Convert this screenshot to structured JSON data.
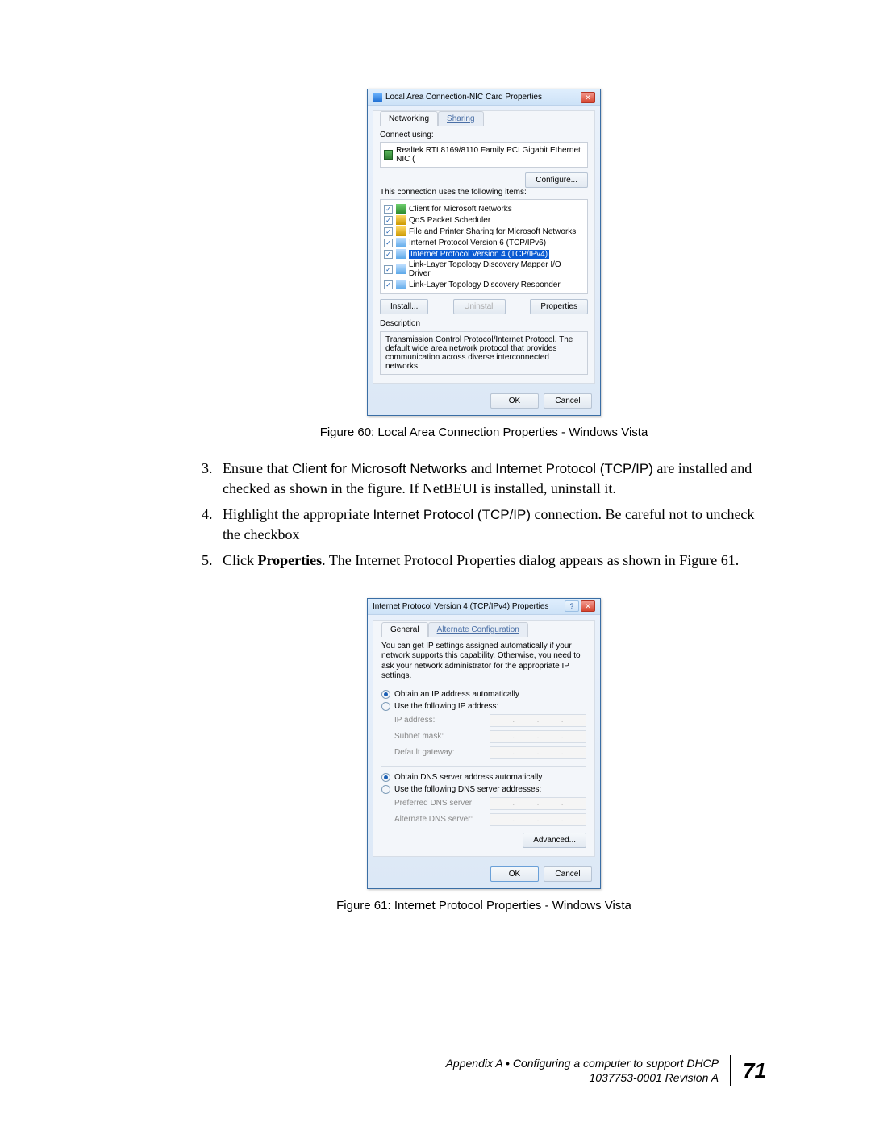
{
  "dialog1": {
    "title": "Local Area Connection-NIC Card Properties",
    "tabs": [
      "Networking",
      "Sharing"
    ],
    "connect_label": "Connect using:",
    "adapter": "Realtek RTL8169/8110 Family PCI Gigabit Ethernet NIC (",
    "configure_btn": "Configure...",
    "uses_label": "This connection uses the following items:",
    "items": [
      "Client for Microsoft Networks",
      "QoS Packet Scheduler",
      "File and Printer Sharing for Microsoft Networks",
      "Internet Protocol Version 6 (TCP/IPv6)",
      "Internet Protocol Version 4 (TCP/IPv4)",
      "Link-Layer Topology Discovery Mapper I/O Driver",
      "Link-Layer Topology Discovery Responder"
    ],
    "install_btn": "Install...",
    "uninstall_btn": "Uninstall",
    "properties_btn": "Properties",
    "desc_label": "Description",
    "desc_text": "Transmission Control Protocol/Internet Protocol. The default wide area network protocol that provides communication across diverse interconnected networks.",
    "ok": "OK",
    "cancel": "Cancel"
  },
  "caption1": "Figure 60: Local Area Connection Properties - Windows Vista",
  "steps": {
    "s3a": "Ensure that ",
    "s3b": "Client for Microsoft Networks",
    "s3c": " and ",
    "s3d": "Internet Protocol (TCP/IP)",
    "s3e": " are installed and checked as shown in the figure. If NetBEUI is installed, uninstall it.",
    "s4a": "Highlight the appropriate ",
    "s4b": "Internet Protocol (TCP/IP)",
    "s4c": " connection. Be careful not to uncheck the checkbox",
    "s5a": "Click ",
    "s5b": "Properties",
    "s5c": ". The Internet Protocol Properties dialog appears as shown in Figure 61."
  },
  "dialog2": {
    "title": "Internet Protocol Version 4 (TCP/IPv4) Properties",
    "tabs": [
      "General",
      "Alternate Configuration"
    ],
    "note": "You can get IP settings assigned automatically if your network supports this capability. Otherwise, you need to ask your network administrator for the appropriate IP settings.",
    "r1": "Obtain an IP address automatically",
    "r2": "Use the following IP address:",
    "f_ip": "IP address:",
    "f_mask": "Subnet mask:",
    "f_gw": "Default gateway:",
    "r3": "Obtain DNS server address automatically",
    "r4": "Use the following DNS server addresses:",
    "f_pdns": "Preferred DNS server:",
    "f_adns": "Alternate DNS server:",
    "adv_btn": "Advanced...",
    "ok": "OK",
    "cancel": "Cancel"
  },
  "caption2": "Figure 61: Internet Protocol Properties - Windows Vista",
  "footer": {
    "line1": "Appendix A • Configuring a computer to support DHCP",
    "line2": "1037753-0001  Revision A",
    "page": "71"
  }
}
